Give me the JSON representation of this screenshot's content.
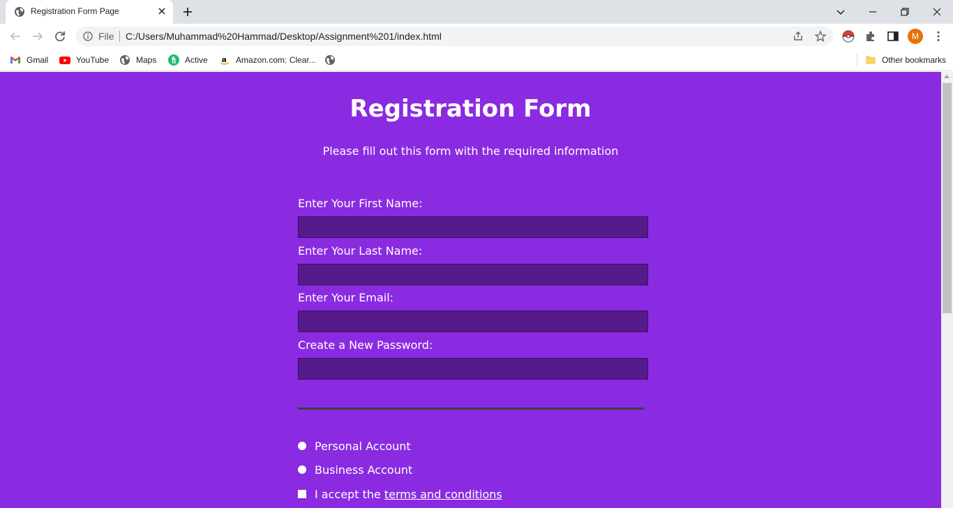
{
  "browser": {
    "tab_title": "Registration Form Page",
    "url_scheme_label": "File",
    "url": "C:/Users/Muhammad%20Hammad/Desktop/Assignment%201/index.html",
    "profile_initial": "M",
    "bookmarks": [
      {
        "label": "Gmail",
        "icon": "gmail-icon"
      },
      {
        "label": "YouTube",
        "icon": "youtube-icon"
      },
      {
        "label": "Maps",
        "icon": "globe-icon"
      },
      {
        "label": "Active",
        "icon": "fiverr-icon"
      },
      {
        "label": "Amazon.com: Clear...",
        "icon": "amazon-icon"
      }
    ],
    "other_bookmarks": "Other bookmarks"
  },
  "page": {
    "background": "#8a2be2",
    "input_background": "#551a8b",
    "title": "Registration Form",
    "subtitle": "Please fill out this form with the required information",
    "fields": [
      {
        "label": "Enter Your First Name:",
        "value": ""
      },
      {
        "label": "Enter Your Last Name:",
        "value": ""
      },
      {
        "label": "Enter Your Email:",
        "value": ""
      },
      {
        "label": "Create a New Password:",
        "value": ""
      }
    ],
    "account_options": [
      {
        "label": "Personal Account",
        "selected": false
      },
      {
        "label": "Business Account",
        "selected": false
      }
    ],
    "terms": {
      "prefix": "I accept the",
      "link_text": "terms and conditions",
      "checked": false
    }
  }
}
